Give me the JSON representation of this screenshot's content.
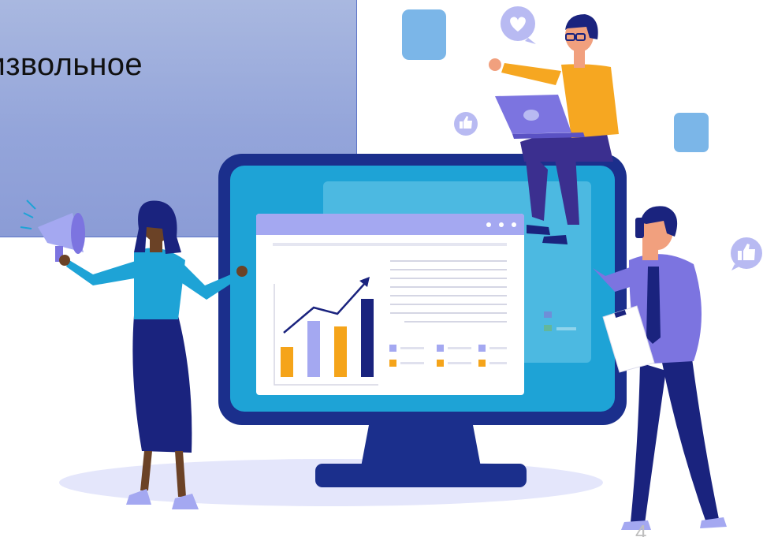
{
  "slide": {
    "title": "оизвольное",
    "page_number": "4"
  },
  "colors": {
    "panel": "#9aa9dc",
    "monitor_frame": "#1b2f8c",
    "monitor_screen": "#1ea3d6",
    "accent_orange": "#f5a41a",
    "accent_purple": "#a4a8f1",
    "dark_navy": "#1a237e"
  },
  "icons": [
    "megaphone-icon",
    "heart-icon",
    "thumbs-up-icon",
    "laptop-icon",
    "phone-icon",
    "clipboard-icon"
  ]
}
